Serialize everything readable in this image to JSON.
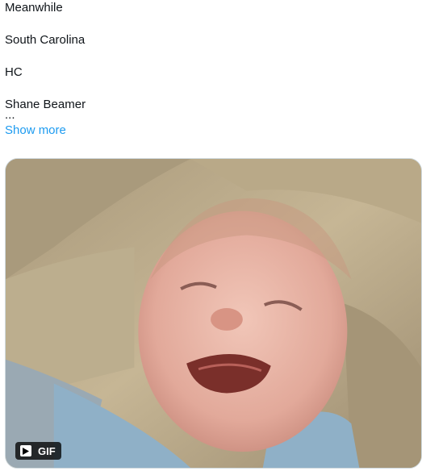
{
  "tweet": {
    "lines": [
      "Meanwhile",
      "South Carolina",
      "HC",
      "Shane Beamer"
    ],
    "truncation": "...",
    "show_more_label": "Show more"
  },
  "media": {
    "type": "gif",
    "badge_label": "GIF",
    "play_icon": "play-icon",
    "content": "video of a crying baby lying on a beige couch in a light blue shirt"
  },
  "colors": {
    "text": "#0f1419",
    "link": "#1d9bf0",
    "badge_bg": "#000000",
    "badge_text": "#ffffff"
  }
}
